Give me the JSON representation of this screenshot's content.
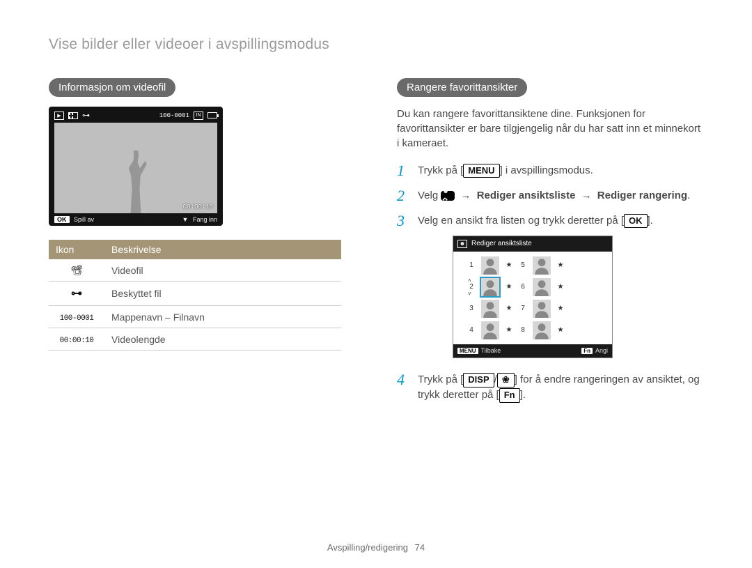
{
  "page_title": "Vise bilder eller videoer i avspillingsmodus",
  "left": {
    "heading": "Informasjon om videofil",
    "lcd": {
      "file_counter": "100-0001",
      "timer": "00:00:10",
      "bottom_left_key": "OK",
      "bottom_left": "Spill av",
      "bottom_right": "Fang inn"
    },
    "table": {
      "head_icon": "Ikon",
      "head_desc": "Beskrivelse",
      "rows": [
        {
          "icon_class": "ic-film",
          "icon_text": "",
          "desc": "Videofil"
        },
        {
          "icon_class": "ic-key",
          "icon_text": "",
          "desc": "Beskyttet fil"
        },
        {
          "icon_class": "mono",
          "icon_text": "100-0001",
          "desc": "Mappenavn – Filnavn"
        },
        {
          "icon_class": "mono",
          "icon_text": "00:00:10",
          "desc": "Videolengde"
        }
      ]
    }
  },
  "right": {
    "heading": "Rangere favorittansikter",
    "intro": "Du kan rangere favorittansiktene dine. Funksjonen for favorittansikter er bare tilgjengelig når du har satt inn et minnekort i kameraet.",
    "step1": {
      "pre": "Trykk på [",
      "key": "MENU",
      "post": "] i avspillingsmodus."
    },
    "step2": {
      "pre": "Velg ",
      "path1": "Rediger ansiktsliste",
      "path2": "Rediger rangering",
      "arrow": "→"
    },
    "step3": {
      "pre": "Velg en ansikt fra listen og trykk deretter på [",
      "key": "OK",
      "post": "]."
    },
    "step4": {
      "pre": "Trykk på [",
      "key1": "DISP",
      "slash": "/",
      "macro": "❀",
      "mid": "] for å endre rangeringen av ansiktet, og trykk deretter på [",
      "key2": "Fn",
      "post": "]."
    },
    "rank_lcd": {
      "title": "Rediger ansiktsliste",
      "back_key": "MENU",
      "back": "Tilbake",
      "set_key": "Fn",
      "set": "Angi",
      "left_nums": [
        "1",
        "2",
        "3",
        "4"
      ],
      "right_nums": [
        "5",
        "6",
        "7",
        "8"
      ],
      "selected_index": 1
    }
  },
  "footer": {
    "section": "Avspilling/redigering",
    "page": "74"
  }
}
